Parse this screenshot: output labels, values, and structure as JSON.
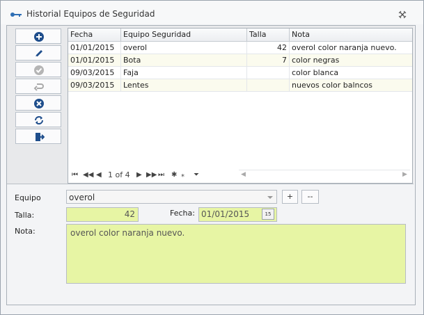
{
  "window": {
    "title": "Historial Equipos de Seguridad"
  },
  "toolbar": {
    "buttons": [
      {
        "name": "add",
        "icon": "plus-circle-icon",
        "color": "#1f4e8c"
      },
      {
        "name": "edit",
        "icon": "pencil-icon",
        "color": "#1f4e8c"
      },
      {
        "name": "save",
        "icon": "check-circle-icon",
        "color": "#a8a8a8"
      },
      {
        "name": "undo",
        "icon": "undo-icon",
        "color": "#a8a8a8"
      },
      {
        "name": "delete",
        "icon": "x-circle-icon",
        "color": "#1f4e8c"
      },
      {
        "name": "refresh",
        "icon": "refresh-icon",
        "color": "#1f4e8c"
      },
      {
        "name": "exit",
        "icon": "exit-door-icon",
        "color": "#1f4e8c"
      }
    ]
  },
  "grid": {
    "columns": [
      "Fecha",
      "Equipo Seguridad",
      "Talla",
      "Nota"
    ],
    "rows": [
      {
        "fecha": "01/01/2015",
        "equipo": "overol",
        "talla": "42",
        "nota": "overol color naranja nuevo."
      },
      {
        "fecha": "01/01/2015",
        "equipo": "Bota",
        "talla": "7",
        "nota": "color negras"
      },
      {
        "fecha": "09/03/2015",
        "equipo": "Faja",
        "talla": "",
        "nota": "color blanca"
      },
      {
        "fecha": "09/03/2015",
        "equipo": "Lentes",
        "talla": "",
        "nota": "nuevos color balncos"
      }
    ],
    "pager": {
      "position": "1 of 4"
    }
  },
  "form": {
    "equipo_label": "Equipo",
    "equipo_value": "overol",
    "add_label": "+",
    "remove_label": "--",
    "talla_label": "Talla:",
    "talla_value": "42",
    "fecha_label": "Fecha:",
    "fecha_value": "01/01/2015",
    "calendar_label": "15",
    "nota_label": "Nota:",
    "nota_value": "overol color naranja nuevo."
  },
  "colors": {
    "field_bg": "#e7f5a4",
    "accent": "#1f4e8c"
  }
}
